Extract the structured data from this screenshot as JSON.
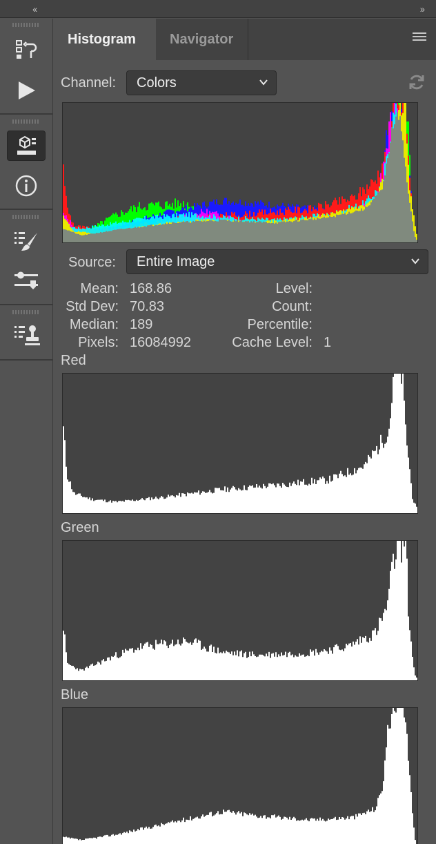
{
  "collapse": {
    "left": "‹‹",
    "right": "››"
  },
  "tabs": [
    {
      "label": "Histogram",
      "active": true
    },
    {
      "label": "Navigator",
      "active": false
    }
  ],
  "channel": {
    "label": "Channel:",
    "value": "Colors"
  },
  "source": {
    "label": "Source:",
    "value": "Entire Image"
  },
  "stats": {
    "mean_label": "Mean:",
    "mean": "168.86",
    "std_label": "Std Dev:",
    "std": "70.83",
    "median_label": "Median:",
    "median": "189",
    "pixels_label": "Pixels:",
    "pixels": "16084992",
    "level_label": "Level:",
    "level": "",
    "count_label": "Count:",
    "count": "",
    "percentile_label": "Percentile:",
    "percentile": "",
    "cache_label": "Cache Level:",
    "cache": "1"
  },
  "channels": [
    {
      "label": "Red"
    },
    {
      "label": "Green"
    },
    {
      "label": "Blue"
    }
  ],
  "toolbar_icons": [
    "history-icon",
    "actions-play-icon",
    "properties-icon",
    "info-icon",
    "brush-presets-icon",
    "adjustments-icon",
    "clone-source-icon"
  ],
  "colors": {
    "panel": "#535353",
    "tabbar": "#424242",
    "histogram_bg": "#434343",
    "histogram_fill": "#ffffff"
  }
}
